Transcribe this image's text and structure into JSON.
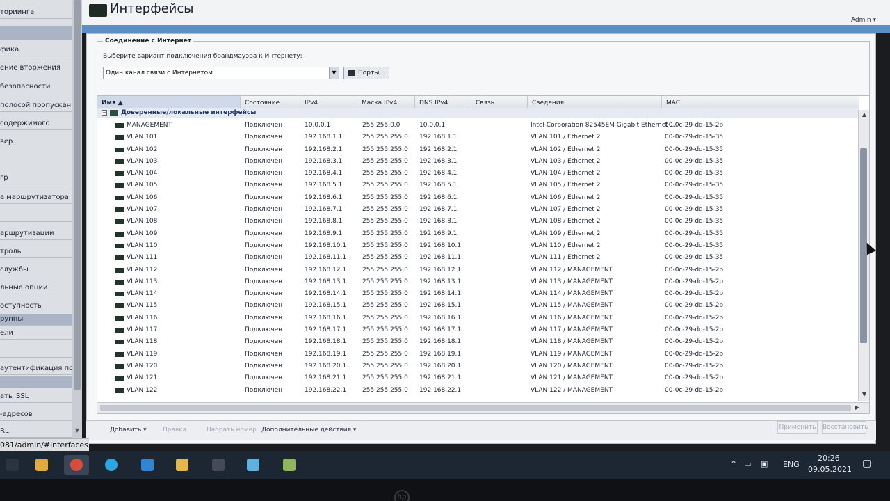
{
  "sidebar": {
    "items": [
      {
        "label": "ториинга",
        "selected": false
      },
      {
        "label": "",
        "selected": true
      },
      {
        "label": "фика",
        "selected": false
      },
      {
        "label": "ение вторжения",
        "selected": false
      },
      {
        "label": "безопасности",
        "selected": false
      },
      {
        "label": " полосой пропускания",
        "selected": false
      },
      {
        "label": " содержимого",
        "selected": false
      },
      {
        "label": "вер",
        "selected": false
      },
      {
        "label": "",
        "selected": false
      },
      {
        "label": "гр",
        "selected": false
      },
      {
        "label": "а маршрутизатора IPv6",
        "selected": false
      },
      {
        "label": "",
        "selected": false
      },
      {
        "label": "аршрутизации",
        "selected": false
      },
      {
        "label": "троль",
        "selected": false
      },
      {
        "label": " службы",
        "selected": false
      },
      {
        "label": "льные опции",
        "selected": false
      },
      {
        "label": "оступность",
        "selected": false
      },
      {
        "label": "руппы",
        "selected": true
      },
      {
        "label": "ели",
        "selected": false
      },
      {
        "label": "",
        "selected": false
      },
      {
        "label": "аутентификация польз",
        "selected": false
      },
      {
        "label": "",
        "selected": true
      },
      {
        "label": "аты SSL",
        "selected": false
      },
      {
        "label": "-адресов",
        "selected": false
      },
      {
        "label": "RL",
        "selected": false
      }
    ]
  },
  "header": {
    "title": "Интерфейсы",
    "admin": "Admin ▾"
  },
  "connection": {
    "legend": "Соединение с Интернет",
    "label": "Выберите вариант подключения брандмауэра к Интернету:",
    "selected": "Один канал связи с Интернетом",
    "ports_button": "Порты..."
  },
  "table": {
    "columns": [
      "Имя ▲",
      "Состояние",
      "IPv4",
      "Маска IPv4",
      "DNS IPv4",
      "Связь",
      "Сведения",
      "MAC"
    ],
    "group_label": "Доверенные/локальные интерфейсы",
    "rows": [
      {
        "name": "MANAGEMENT",
        "state": "Подключен",
        "ipv4": "10.0.0.1",
        "mask": "255.255.0.0",
        "dns": "10.0.0.1",
        "link": "",
        "info": "Intel Corporation 82545EM Gigabit Ethernet ...",
        "mac": "00-0c-29-dd-15-2b"
      },
      {
        "name": "VLAN 101",
        "state": "Подключен",
        "ipv4": "192.168.1.1",
        "mask": "255.255.255.0",
        "dns": "192.168.1.1",
        "link": "",
        "info": "VLAN 101 / Ethernet 2",
        "mac": "00-0c-29-dd-15-35"
      },
      {
        "name": "VLAN 102",
        "state": "Подключен",
        "ipv4": "192.168.2.1",
        "mask": "255.255.255.0",
        "dns": "192.168.2.1",
        "link": "",
        "info": "VLAN 102 / Ethernet 2",
        "mac": "00-0c-29-dd-15-35"
      },
      {
        "name": "VLAN 103",
        "state": "Подключен",
        "ipv4": "192.168.3.1",
        "mask": "255.255.255.0",
        "dns": "192.168.3.1",
        "link": "",
        "info": "VLAN 103 / Ethernet 2",
        "mac": "00-0c-29-dd-15-35"
      },
      {
        "name": "VLAN 104",
        "state": "Подключен",
        "ipv4": "192.168.4.1",
        "mask": "255.255.255.0",
        "dns": "192.168.4.1",
        "link": "",
        "info": "VLAN 104 / Ethernet 2",
        "mac": "00-0c-29-dd-15-35"
      },
      {
        "name": "VLAN 105",
        "state": "Подключен",
        "ipv4": "192.168.5.1",
        "mask": "255.255.255.0",
        "dns": "192.168.5.1",
        "link": "",
        "info": "VLAN 105 / Ethernet 2",
        "mac": "00-0c-29-dd-15-35"
      },
      {
        "name": "VLAN 106",
        "state": "Подключен",
        "ipv4": "192.168.6.1",
        "mask": "255.255.255.0",
        "dns": "192.168.6.1",
        "link": "",
        "info": "VLAN 106 / Ethernet 2",
        "mac": "00-0c-29-dd-15-35"
      },
      {
        "name": "VLAN 107",
        "state": "Подключен",
        "ipv4": "192.168.7.1",
        "mask": "255.255.255.0",
        "dns": "192.168.7.1",
        "link": "",
        "info": "VLAN 107 / Ethernet 2",
        "mac": "00-0c-29-dd-15-35"
      },
      {
        "name": "VLAN 108",
        "state": "Подключен",
        "ipv4": "192.168.8.1",
        "mask": "255.255.255.0",
        "dns": "192.168.8.1",
        "link": "",
        "info": "VLAN 108 / Ethernet 2",
        "mac": "00-0c-29-dd-15-35"
      },
      {
        "name": "VLAN 109",
        "state": "Подключен",
        "ipv4": "192.168.9.1",
        "mask": "255.255.255.0",
        "dns": "192.168.9.1",
        "link": "",
        "info": "VLAN 109 / Ethernet 2",
        "mac": "00-0c-29-dd-15-35"
      },
      {
        "name": "VLAN 110",
        "state": "Подключен",
        "ipv4": "192.168.10.1",
        "mask": "255.255.255.0",
        "dns": "192.168.10.1",
        "link": "",
        "info": "VLAN 110 / Ethernet 2",
        "mac": "00-0c-29-dd-15-35"
      },
      {
        "name": "VLAN 111",
        "state": "Подключен",
        "ipv4": "192.168.11.1",
        "mask": "255.255.255.0",
        "dns": "192.168.11.1",
        "link": "",
        "info": "VLAN 111 / Ethernet 2",
        "mac": "00-0c-29-dd-15-35"
      },
      {
        "name": "VLAN 112",
        "state": "Подключен",
        "ipv4": "192.168.12.1",
        "mask": "255.255.255.0",
        "dns": "192.168.12.1",
        "link": "",
        "info": "VLAN 112 / MANAGEMENT",
        "mac": "00-0c-29-dd-15-2b"
      },
      {
        "name": "VLAN 113",
        "state": "Подключен",
        "ipv4": "192.168.13.1",
        "mask": "255.255.255.0",
        "dns": "192.168.13.1",
        "link": "",
        "info": "VLAN 113 / MANAGEMENT",
        "mac": "00-0c-29-dd-15-2b"
      },
      {
        "name": "VLAN 114",
        "state": "Подключен",
        "ipv4": "192.168.14.1",
        "mask": "255.255.255.0",
        "dns": "192.168.14.1",
        "link": "",
        "info": "VLAN 114 / MANAGEMENT",
        "mac": "00-0c-29-dd-15-2b"
      },
      {
        "name": "VLAN 115",
        "state": "Подключен",
        "ipv4": "192.168.15.1",
        "mask": "255.255.255.0",
        "dns": "192.168.15.1",
        "link": "",
        "info": "VLAN 115 / MANAGEMENT",
        "mac": "00-0c-29-dd-15-2b"
      },
      {
        "name": "VLAN 116",
        "state": "Подключен",
        "ipv4": "192.168.16.1",
        "mask": "255.255.255.0",
        "dns": "192.168.16.1",
        "link": "",
        "info": "VLAN 116 / MANAGEMENT",
        "mac": "00-0c-29-dd-15-2b"
      },
      {
        "name": "VLAN 117",
        "state": "Подключен",
        "ipv4": "192.168.17.1",
        "mask": "255.255.255.0",
        "dns": "192.168.17.1",
        "link": "",
        "info": "VLAN 117 / MANAGEMENT",
        "mac": "00-0c-29-dd-15-2b"
      },
      {
        "name": "VLAN 118",
        "state": "Подключен",
        "ipv4": "192.168.18.1",
        "mask": "255.255.255.0",
        "dns": "192.168.18.1",
        "link": "",
        "info": "VLAN 118 / MANAGEMENT",
        "mac": "00-0c-29-dd-15-2b"
      },
      {
        "name": "VLAN 119",
        "state": "Подключен",
        "ipv4": "192.168.19.1",
        "mask": "255.255.255.0",
        "dns": "192.168.19.1",
        "link": "",
        "info": "VLAN 119 / MANAGEMENT",
        "mac": "00-0c-29-dd-15-2b"
      },
      {
        "name": "VLAN 120",
        "state": "Подключен",
        "ipv4": "192.168.20.1",
        "mask": "255.255.255.0",
        "dns": "192.168.20.1",
        "link": "",
        "info": "VLAN 120 / MANAGEMENT",
        "mac": "00-0c-29-dd-15-2b"
      },
      {
        "name": "VLAN 121",
        "state": "Подключен",
        "ipv4": "192.168.21.1",
        "mask": "255.255.255.0",
        "dns": "192.168.21.1",
        "link": "",
        "info": "VLAN 121 / MANAGEMENT",
        "mac": "00-0c-29-dd-15-2b"
      },
      {
        "name": "VLAN 122",
        "state": "Подключен",
        "ipv4": "192.168.22.1",
        "mask": "255.255.255.0",
        "dns": "192.168.22.1",
        "link": "",
        "info": "VLAN 122 / MANAGEMENT",
        "mac": "00-0c-29-dd-15-2b"
      }
    ]
  },
  "footer": {
    "add": "Добавить ▾",
    "edit": "Правка",
    "dial": "Набрать номер",
    "more": "Дополнительные действия ▾",
    "apply": "Применить",
    "restore": "Восстановить"
  },
  "status": {
    "url": "081/admin/#interfaces"
  },
  "taskbar": {
    "apps": [
      {
        "icon": "start-icon",
        "color": "#2b3340",
        "active": false
      },
      {
        "icon": "folder-icon",
        "color": "#e2a93b",
        "active": false
      },
      {
        "icon": "chrome-icon",
        "color": "#d94b3b",
        "active": true
      },
      {
        "icon": "telegram-icon",
        "color": "#2ca5e0",
        "active": false
      },
      {
        "icon": "edge-icon",
        "color": "#2e86d6",
        "active": false
      },
      {
        "icon": "window-app-icon",
        "color": "#e8b74a",
        "active": false
      },
      {
        "icon": "terminal-icon",
        "color": "#444b56",
        "active": false
      },
      {
        "icon": "monitor-app-icon",
        "color": "#5fb2e0",
        "active": false
      },
      {
        "icon": "network-app-icon",
        "color": "#8fb75a",
        "active": false
      }
    ],
    "lang": "ENG",
    "time": "20:26",
    "date": "09.05.2021"
  },
  "bezel": {
    "brand": "hp"
  }
}
